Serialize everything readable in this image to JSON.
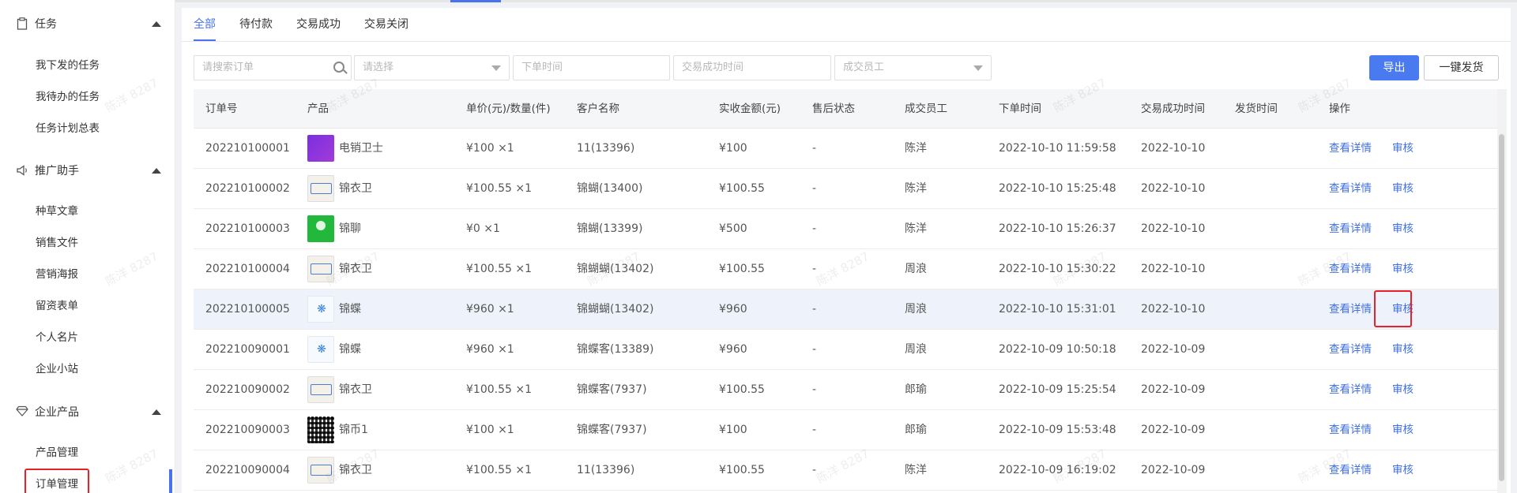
{
  "sidebar": {
    "groups": [
      {
        "label": "任务",
        "icon": "clipboard-icon",
        "items": [
          "我下发的任务",
          "我待办的任务",
          "任务计划总表"
        ]
      },
      {
        "label": "推广助手",
        "icon": "megaphone-icon",
        "items": [
          "种草文章",
          "销售文件",
          "营销海报",
          "留资表单",
          "个人名片",
          "企业小站"
        ]
      },
      {
        "label": "企业产品",
        "icon": "diamond-icon",
        "items": [
          "产品管理",
          "订单管理"
        ]
      }
    ],
    "active_item": "订单管理"
  },
  "tabs": [
    "全部",
    "待付款",
    "交易成功",
    "交易关闭"
  ],
  "active_tab": "全部",
  "filters": {
    "search_placeholder": "请搜索订单",
    "select_placeholder": "请选择",
    "order_time_placeholder": "下单时间",
    "success_time_placeholder": "交易成功时间",
    "employee_placeholder": "成交员工"
  },
  "buttons": {
    "export": "导出",
    "ship_all": "一键发货"
  },
  "table": {
    "headers": [
      "订单号",
      "产品",
      "单价(元)/数量(件)",
      "客户名称",
      "实收金额(元)",
      "售后状态",
      "成交员工",
      "下单时间",
      "交易成功时间",
      "发货时间",
      "操作"
    ],
    "rows": [
      {
        "order_no": "202210100001",
        "product": "电销卫士",
        "thumb": "purple",
        "price_qty": "¥100 ×1",
        "customer": "11(13396)",
        "amount": "¥100",
        "after_sale": "-",
        "employee": "陈洋",
        "order_time": "2022-10-10 11:59:58",
        "success_time": "2022-10-10",
        "ship_time": "",
        "actions": [
          "查看详情",
          "审核"
        ]
      },
      {
        "order_no": "202210100002",
        "product": "锦衣卫",
        "thumb": "jyw",
        "price_qty": "¥100.55 ×1",
        "customer": "锦蝴(13400)",
        "amount": "¥100.55",
        "after_sale": "-",
        "employee": "陈洋",
        "order_time": "2022-10-10 15:25:48",
        "success_time": "2022-10-10",
        "ship_time": "",
        "actions": [
          "查看详情",
          "审核"
        ]
      },
      {
        "order_no": "202210100003",
        "product": "锦聊",
        "thumb": "green",
        "price_qty": "¥0 ×1",
        "customer": "锦蝴(13399)",
        "amount": "¥500",
        "after_sale": "-",
        "employee": "陈洋",
        "order_time": "2022-10-10 15:26:37",
        "success_time": "2022-10-10",
        "ship_time": "",
        "actions": [
          "查看详情",
          "审核"
        ]
      },
      {
        "order_no": "202210100004",
        "product": "锦衣卫",
        "thumb": "jyw",
        "price_qty": "¥100.55 ×1",
        "customer": "锦蝴蝴(13402)",
        "amount": "¥100.55",
        "after_sale": "-",
        "employee": "周浪",
        "order_time": "2022-10-10 15:30:22",
        "success_time": "2022-10-10",
        "ship_time": "",
        "actions": [
          "查看详情",
          "审核"
        ]
      },
      {
        "order_no": "202210100005",
        "product": "锦蝶",
        "thumb": "bf",
        "price_qty": "¥960 ×1",
        "customer": "锦蝴蝴(13402)",
        "amount": "¥960",
        "after_sale": "-",
        "employee": "周浪",
        "order_time": "2022-10-10 15:31:01",
        "success_time": "2022-10-10",
        "ship_time": "",
        "actions": [
          "查看详情",
          "审核"
        ]
      },
      {
        "order_no": "202210090001",
        "product": "锦蝶",
        "thumb": "bf",
        "price_qty": "¥960 ×1",
        "customer": "锦蝶客(13389)",
        "amount": "¥960",
        "after_sale": "-",
        "employee": "周浪",
        "order_time": "2022-10-09 10:50:18",
        "success_time": "2022-10-09",
        "ship_time": "",
        "actions": [
          "查看详情",
          "审核"
        ]
      },
      {
        "order_no": "202210090002",
        "product": "锦衣卫",
        "thumb": "jyw",
        "price_qty": "¥100.55 ×1",
        "customer": "锦蝶客(7937)",
        "amount": "¥100.55",
        "after_sale": "-",
        "employee": "郎瑜",
        "order_time": "2022-10-09 15:25:54",
        "success_time": "2022-10-09",
        "ship_time": "",
        "actions": [
          "查看详情",
          "审核"
        ]
      },
      {
        "order_no": "202210090003",
        "product": "锦币1",
        "thumb": "qr",
        "price_qty": "¥100 ×1",
        "customer": "锦蝶客(7937)",
        "amount": "¥100",
        "after_sale": "-",
        "employee": "郎瑜",
        "order_time": "2022-10-09 15:53:48",
        "success_time": "2022-10-09",
        "ship_time": "",
        "actions": [
          "查看详情",
          "审核"
        ]
      },
      {
        "order_no": "202210090004",
        "product": "锦衣卫",
        "thumb": "jyw",
        "price_qty": "¥100.55 ×1",
        "customer": "11(13396)",
        "amount": "¥100.55",
        "after_sale": "-",
        "employee": "陈洋",
        "order_time": "2022-10-09 16:19:02",
        "success_time": "2022-10-09",
        "ship_time": "",
        "actions": [
          "查看详情",
          "审核"
        ]
      }
    ]
  },
  "watermark": "陈洋 8287",
  "colors": {
    "accent": "#4a72ee",
    "highlight": "#e8202a",
    "link": "#3f6fe6"
  }
}
